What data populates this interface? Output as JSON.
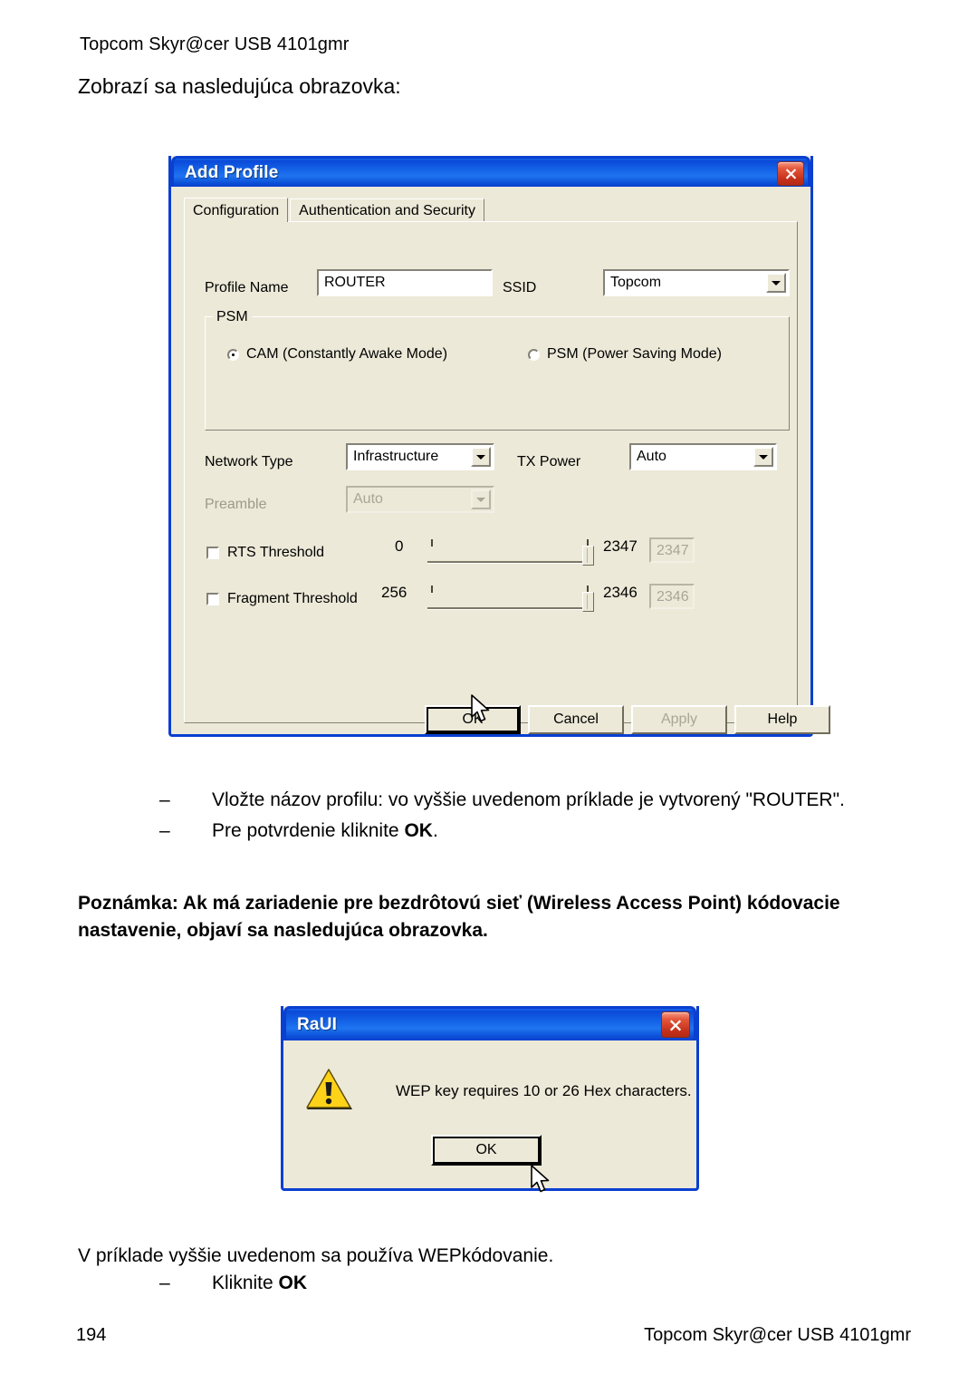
{
  "page": {
    "header": "Topcom Skyr@cer USB 4101gmr",
    "intro": "Zobrazí sa nasledujúca obrazovka:",
    "bullets": [
      {
        "dash": "–",
        "text": "Vložte názov profilu: vo vyššie uvedenom príklade je vytvorený \"ROUTER\"."
      },
      {
        "dash": "–",
        "text_before": "Pre potvrdenie kliknite ",
        "bold": "OK",
        "text_after": "."
      }
    ],
    "note": "Poznámka: Ak má zariadenie pre bezdrôtovú sieť (Wireless Access Point) kódovacie nastavenie, objaví sa nasledujúca obrazovka.",
    "after_text": "V príklade vyššie uvedenom sa používa WEPkódovanie.",
    "after_bullet": {
      "dash": "–",
      "text_before": "Kliknite ",
      "bold": "OK"
    },
    "footer_page": "194",
    "footer_title": "Topcom Skyr@cer USB 4101gmr"
  },
  "add_profile": {
    "title": "Add Profile",
    "close_icon": "close-icon",
    "tabs": [
      {
        "label": "Configuration",
        "active": true
      },
      {
        "label": "Authentication and Security",
        "active": false
      }
    ],
    "fields": {
      "profile_name_label": "Profile Name",
      "profile_name_value": "ROUTER",
      "ssid_label": "SSID",
      "ssid_value": "Topcom",
      "network_type_label": "Network Type",
      "network_type_value": "Infrastructure",
      "tx_power_label": "TX Power",
      "tx_power_value": "Auto",
      "preamble_label": "Preamble",
      "preamble_value": "Auto"
    },
    "psm": {
      "legend": "PSM",
      "options": [
        {
          "label": "CAM (Constantly Awake Mode)",
          "selected": true
        },
        {
          "label": "PSM (Power Saving Mode)",
          "selected": false
        }
      ]
    },
    "thresholds": [
      {
        "label": "RTS Threshold",
        "checked": false,
        "min": "0",
        "max": "2347",
        "value": "2347"
      },
      {
        "label": "Fragment Threshold",
        "checked": false,
        "min": "256",
        "max": "2346",
        "value": "2346"
      }
    ],
    "buttons": [
      {
        "label": "OK",
        "state": "default"
      },
      {
        "label": "Cancel",
        "state": "normal"
      },
      {
        "label": "Apply",
        "state": "disabled"
      },
      {
        "label": "Help",
        "state": "normal"
      }
    ]
  },
  "raui": {
    "title": "RaUI",
    "close_icon": "close-icon",
    "warning_icon": "warning-triangle-icon",
    "message": "WEP key requires 10 or 26 Hex characters.",
    "ok_label": "OK"
  }
}
